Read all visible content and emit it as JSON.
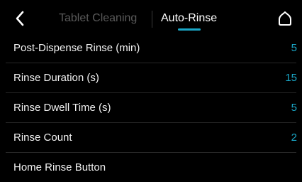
{
  "colors": {
    "background": "#000000",
    "accent": "#1aa7c7",
    "inactive_text": "#5a5a5a",
    "divider": "#262626"
  },
  "header": {
    "back_icon": "chevron-left-icon",
    "tabs": [
      {
        "label": "Tablet Cleaning",
        "active": false
      },
      {
        "label": "Auto-Rinse",
        "active": true
      }
    ],
    "home_icon": "home-icon"
  },
  "settings": [
    {
      "label": "Post-Dispense Rinse (min)",
      "value": "5"
    },
    {
      "label": "Rinse Duration (s)",
      "value": "15"
    },
    {
      "label": "Rinse Dwell Time (s)",
      "value": "5"
    },
    {
      "label": "Rinse Count",
      "value": "2"
    },
    {
      "label": "Home Rinse Button",
      "value": ""
    }
  ]
}
